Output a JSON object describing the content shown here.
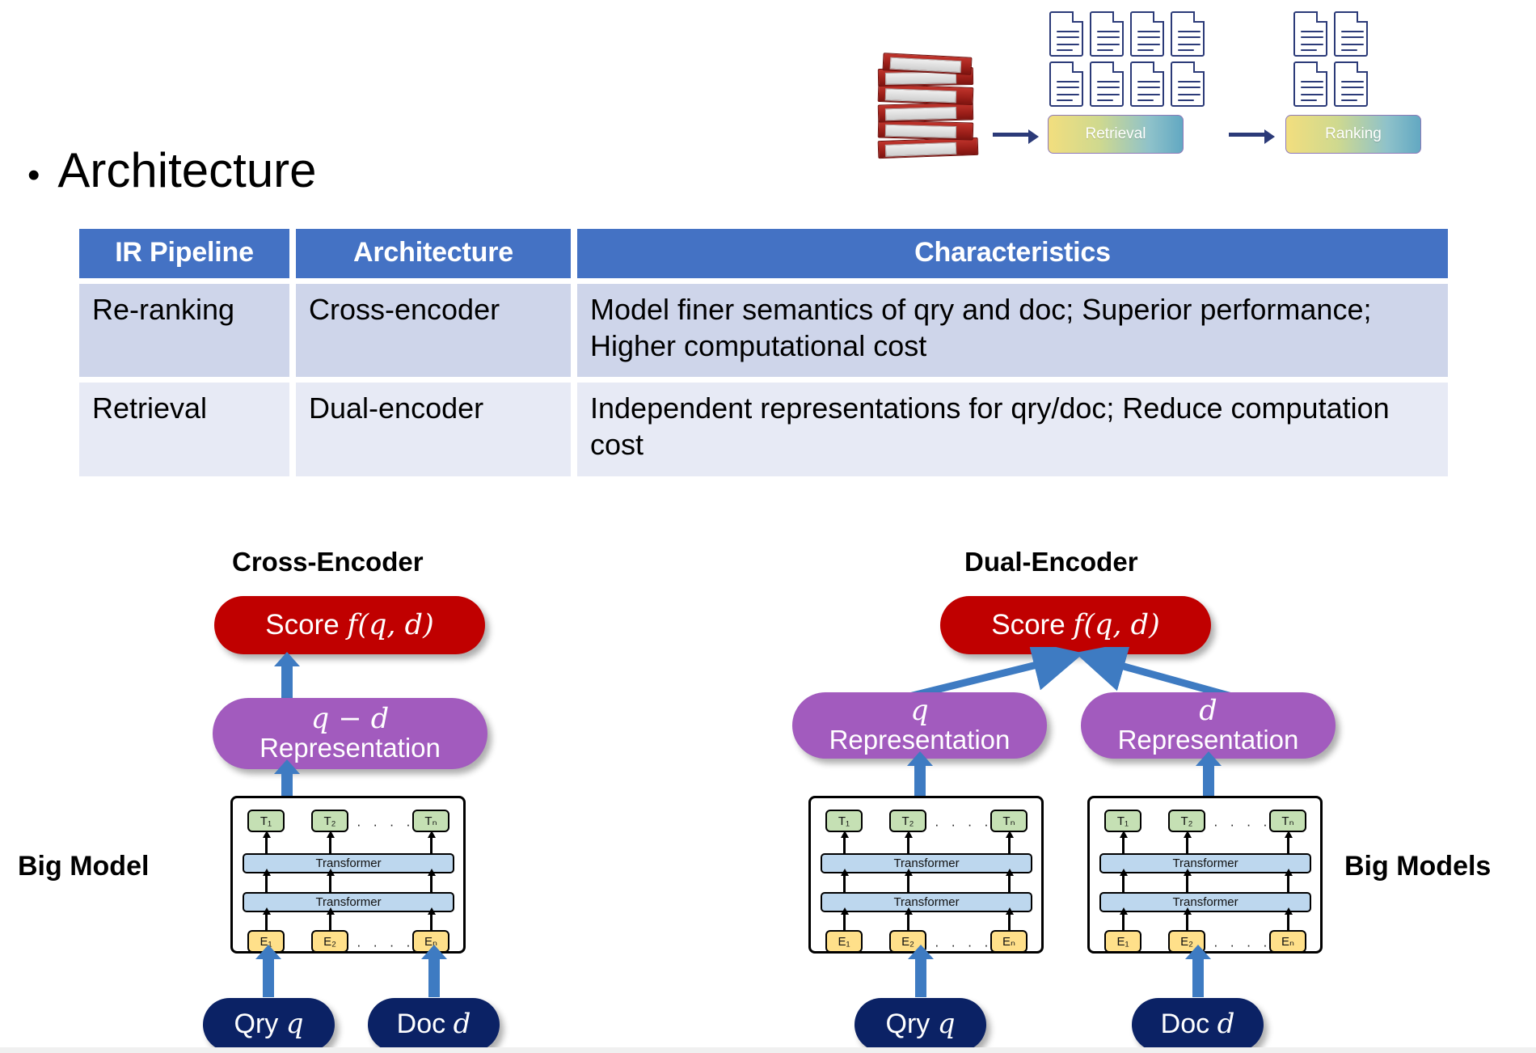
{
  "slide": {
    "bullet": {
      "marker": "•",
      "title": "Architecture"
    }
  },
  "pipeline": {
    "icons": {
      "binders": "binder-stack-icon",
      "document": "document-icon",
      "arrow": "right-arrow-icon"
    },
    "stages": [
      {
        "label": "Retrieval",
        "docs": 8
      },
      {
        "label": "Ranking",
        "docs": 4
      }
    ]
  },
  "table": {
    "headers": [
      "IR Pipeline",
      "Architecture",
      "Characteristics"
    ],
    "rows": [
      {
        "pipeline": "Re-ranking",
        "architecture": "Cross-encoder",
        "characteristics": "Model finer semantics of qry and doc; Superior performance; Higher computational cost"
      },
      {
        "pipeline": "Retrieval",
        "architecture": "Dual-encoder",
        "characteristics": "Independent representations for qry/doc; Reduce computation cost"
      }
    ],
    "colors": {
      "header_bg": "#4472C4",
      "header_fg": "#FFFFFF",
      "row1_bg": "#CED5EA",
      "row2_bg": "#E7EAF5"
    }
  },
  "diagrams": {
    "left": {
      "title": "Cross-Encoder",
      "score": "Score",
      "score_math": "f(q, d)",
      "rep_math": "q − d",
      "rep_label": "Representation",
      "inputs": [
        {
          "label": "Qry",
          "math": "q"
        },
        {
          "label": "Doc",
          "math": "d"
        }
      ],
      "encoder": {
        "outputs": [
          "T₁",
          "T₂",
          "Tₙ"
        ],
        "layers": [
          "Transformer",
          "Transformer"
        ],
        "inputs": [
          "E₁",
          "E₂",
          "Eₙ"
        ],
        "ellipsis": "·  ·  ·  ·"
      }
    },
    "right": {
      "title": "Dual-Encoder",
      "score": "Score",
      "score_math": "f(q, d)",
      "reps": [
        {
          "math": "q",
          "label": "Representation"
        },
        {
          "math": "d",
          "label": "Representation"
        }
      ],
      "inputs": [
        {
          "label": "Qry",
          "math": "q"
        },
        {
          "label": "Doc",
          "math": "d"
        }
      ],
      "encoder": {
        "outputs": [
          "T₁",
          "T₂",
          "Tₙ"
        ],
        "layers": [
          "Transformer",
          "Transformer"
        ],
        "inputs": [
          "E₁",
          "E₂",
          "Eₙ"
        ],
        "ellipsis": "·  ·  ·  ·"
      }
    }
  },
  "annotations": {
    "left_label": "Big Model",
    "right_label": "Big Models"
  },
  "colors": {
    "score_red": "#C00000",
    "rep_purple": "#A25BBE",
    "input_navy": "#0B2265",
    "arrow_blue": "#3E7BC2",
    "token_green": "#C5E0B4",
    "token_yellow": "#FFE08A",
    "transformer_blue": "#BDD7EE"
  }
}
